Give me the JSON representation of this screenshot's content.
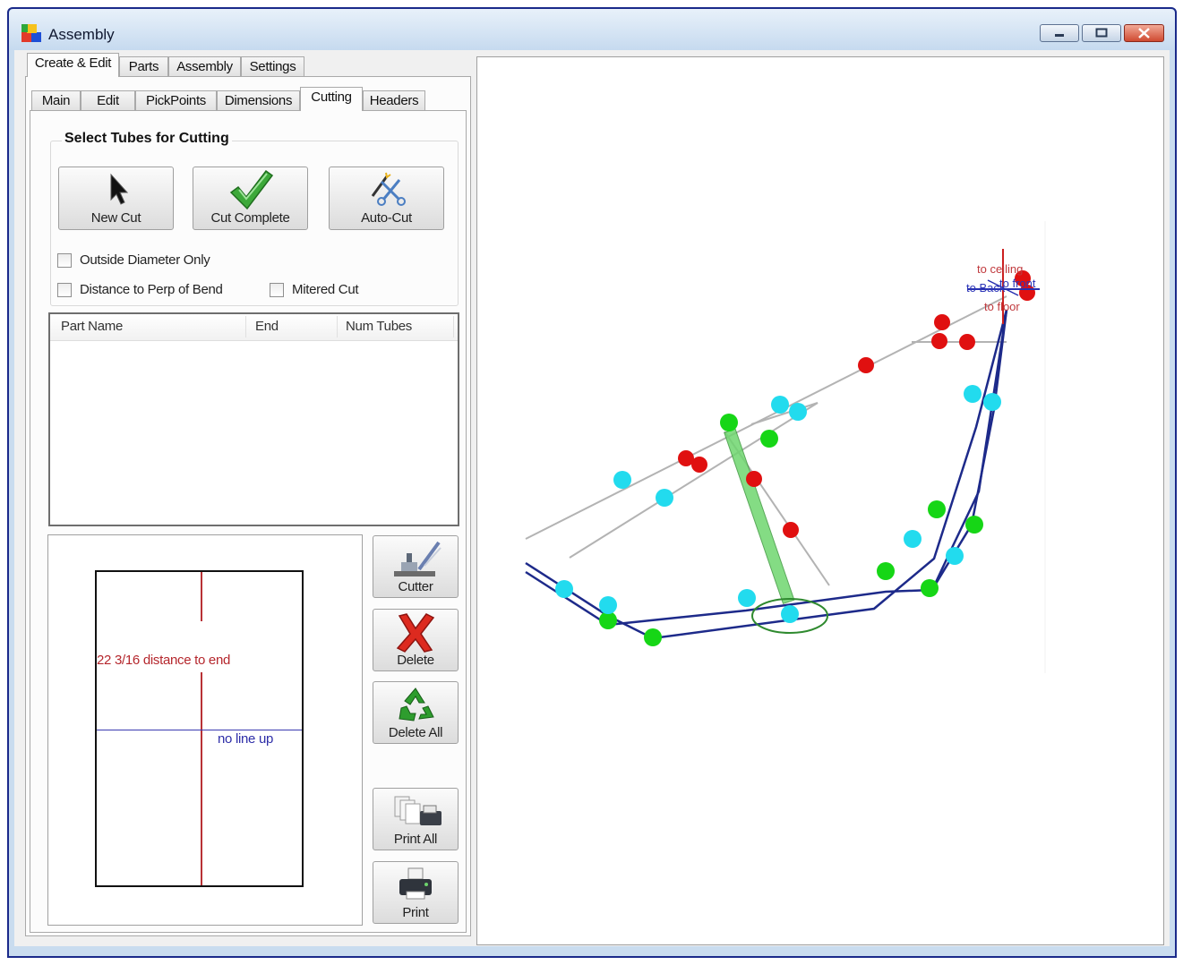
{
  "window": {
    "title": "Assembly"
  },
  "main_tabs": [
    "Create & Edit",
    "Parts",
    "Assembly",
    "Settings"
  ],
  "sub_tabs": [
    "Main",
    "Edit",
    "PickPoints",
    "Dimensions",
    "Cutting",
    "Headers"
  ],
  "cutting": {
    "group_title": "Select  Tubes for Cutting",
    "buttons": {
      "new_cut": "New Cut",
      "cut_complete": "Cut Complete",
      "auto_cut": "Auto-Cut"
    },
    "checkboxes": {
      "outside_diameter_only": {
        "label": "Outside Diameter Only",
        "checked": false
      },
      "distance_to_perp_of_bend": {
        "label": "Distance to Perp of Bend",
        "checked": false
      },
      "mitered_cut": {
        "label": "Mitered Cut",
        "checked": false
      }
    },
    "table": {
      "columns": [
        "Part Name",
        "End",
        "Num Tubes"
      ],
      "rows": []
    },
    "preview": {
      "distance_text": "22  3/16 distance to end",
      "lineup_text": "no line up"
    },
    "side_buttons": {
      "cutter": "Cutter",
      "delete": "Delete",
      "delete_all": "Delete All",
      "print_all": "Print All",
      "print": "Print"
    }
  },
  "viewport": {
    "labels": {
      "ceiling": "to ceiling",
      "back": "to Back",
      "front": "to front",
      "floor": "to floor"
    }
  },
  "colors": {
    "pick_red": "#e01010",
    "pick_green": "#16d616",
    "pick_cyan": "#22dbee",
    "tube_blue": "#1d2a8a",
    "tube_gray": "#b0b0b0",
    "highlight_green": "#6fd66f"
  }
}
